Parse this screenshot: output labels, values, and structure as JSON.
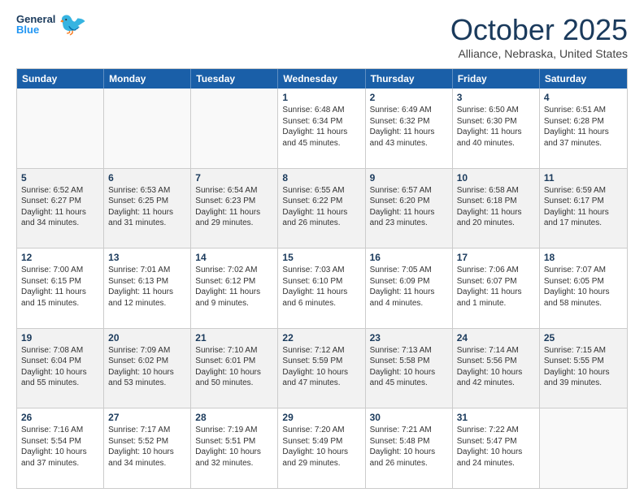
{
  "header": {
    "logo_general": "General",
    "logo_blue": "Blue",
    "month_title": "October 2025",
    "location": "Alliance, Nebraska, United States"
  },
  "calendar": {
    "days_of_week": [
      "Sunday",
      "Monday",
      "Tuesday",
      "Wednesday",
      "Thursday",
      "Friday",
      "Saturday"
    ],
    "rows": [
      [
        {
          "day": "",
          "text": ""
        },
        {
          "day": "",
          "text": ""
        },
        {
          "day": "",
          "text": ""
        },
        {
          "day": "1",
          "text": "Sunrise: 6:48 AM\nSunset: 6:34 PM\nDaylight: 11 hours and 45 minutes."
        },
        {
          "day": "2",
          "text": "Sunrise: 6:49 AM\nSunset: 6:32 PM\nDaylight: 11 hours and 43 minutes."
        },
        {
          "day": "3",
          "text": "Sunrise: 6:50 AM\nSunset: 6:30 PM\nDaylight: 11 hours and 40 minutes."
        },
        {
          "day": "4",
          "text": "Sunrise: 6:51 AM\nSunset: 6:28 PM\nDaylight: 11 hours and 37 minutes."
        }
      ],
      [
        {
          "day": "5",
          "text": "Sunrise: 6:52 AM\nSunset: 6:27 PM\nDaylight: 11 hours and 34 minutes."
        },
        {
          "day": "6",
          "text": "Sunrise: 6:53 AM\nSunset: 6:25 PM\nDaylight: 11 hours and 31 minutes."
        },
        {
          "day": "7",
          "text": "Sunrise: 6:54 AM\nSunset: 6:23 PM\nDaylight: 11 hours and 29 minutes."
        },
        {
          "day": "8",
          "text": "Sunrise: 6:55 AM\nSunset: 6:22 PM\nDaylight: 11 hours and 26 minutes."
        },
        {
          "day": "9",
          "text": "Sunrise: 6:57 AM\nSunset: 6:20 PM\nDaylight: 11 hours and 23 minutes."
        },
        {
          "day": "10",
          "text": "Sunrise: 6:58 AM\nSunset: 6:18 PM\nDaylight: 11 hours and 20 minutes."
        },
        {
          "day": "11",
          "text": "Sunrise: 6:59 AM\nSunset: 6:17 PM\nDaylight: 11 hours and 17 minutes."
        }
      ],
      [
        {
          "day": "12",
          "text": "Sunrise: 7:00 AM\nSunset: 6:15 PM\nDaylight: 11 hours and 15 minutes."
        },
        {
          "day": "13",
          "text": "Sunrise: 7:01 AM\nSunset: 6:13 PM\nDaylight: 11 hours and 12 minutes."
        },
        {
          "day": "14",
          "text": "Sunrise: 7:02 AM\nSunset: 6:12 PM\nDaylight: 11 hours and 9 minutes."
        },
        {
          "day": "15",
          "text": "Sunrise: 7:03 AM\nSunset: 6:10 PM\nDaylight: 11 hours and 6 minutes."
        },
        {
          "day": "16",
          "text": "Sunrise: 7:05 AM\nSunset: 6:09 PM\nDaylight: 11 hours and 4 minutes."
        },
        {
          "day": "17",
          "text": "Sunrise: 7:06 AM\nSunset: 6:07 PM\nDaylight: 11 hours and 1 minute."
        },
        {
          "day": "18",
          "text": "Sunrise: 7:07 AM\nSunset: 6:05 PM\nDaylight: 10 hours and 58 minutes."
        }
      ],
      [
        {
          "day": "19",
          "text": "Sunrise: 7:08 AM\nSunset: 6:04 PM\nDaylight: 10 hours and 55 minutes."
        },
        {
          "day": "20",
          "text": "Sunrise: 7:09 AM\nSunset: 6:02 PM\nDaylight: 10 hours and 53 minutes."
        },
        {
          "day": "21",
          "text": "Sunrise: 7:10 AM\nSunset: 6:01 PM\nDaylight: 10 hours and 50 minutes."
        },
        {
          "day": "22",
          "text": "Sunrise: 7:12 AM\nSunset: 5:59 PM\nDaylight: 10 hours and 47 minutes."
        },
        {
          "day": "23",
          "text": "Sunrise: 7:13 AM\nSunset: 5:58 PM\nDaylight: 10 hours and 45 minutes."
        },
        {
          "day": "24",
          "text": "Sunrise: 7:14 AM\nSunset: 5:56 PM\nDaylight: 10 hours and 42 minutes."
        },
        {
          "day": "25",
          "text": "Sunrise: 7:15 AM\nSunset: 5:55 PM\nDaylight: 10 hours and 39 minutes."
        }
      ],
      [
        {
          "day": "26",
          "text": "Sunrise: 7:16 AM\nSunset: 5:54 PM\nDaylight: 10 hours and 37 minutes."
        },
        {
          "day": "27",
          "text": "Sunrise: 7:17 AM\nSunset: 5:52 PM\nDaylight: 10 hours and 34 minutes."
        },
        {
          "day": "28",
          "text": "Sunrise: 7:19 AM\nSunset: 5:51 PM\nDaylight: 10 hours and 32 minutes."
        },
        {
          "day": "29",
          "text": "Sunrise: 7:20 AM\nSunset: 5:49 PM\nDaylight: 10 hours and 29 minutes."
        },
        {
          "day": "30",
          "text": "Sunrise: 7:21 AM\nSunset: 5:48 PM\nDaylight: 10 hours and 26 minutes."
        },
        {
          "day": "31",
          "text": "Sunrise: 7:22 AM\nSunset: 5:47 PM\nDaylight: 10 hours and 24 minutes."
        },
        {
          "day": "",
          "text": ""
        }
      ]
    ]
  }
}
